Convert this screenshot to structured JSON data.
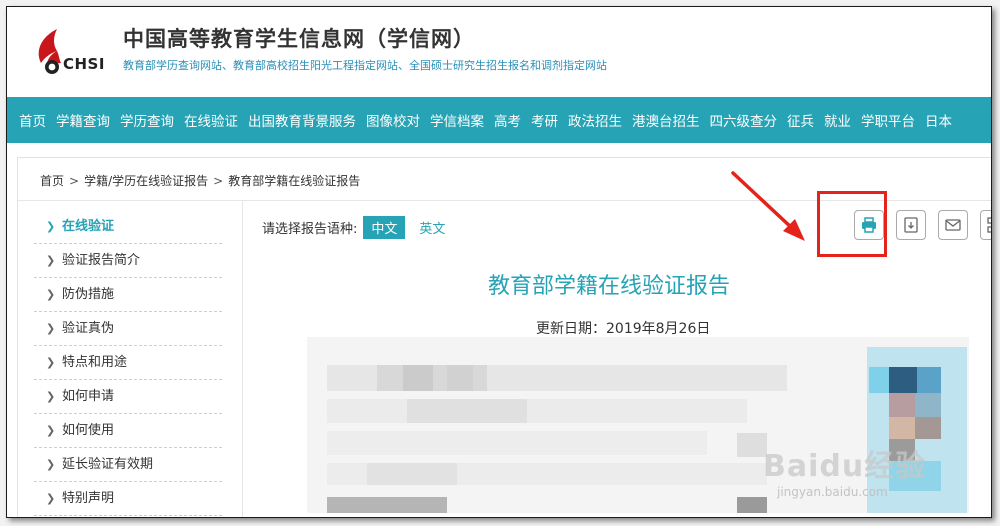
{
  "header": {
    "logo_text": "CHSI",
    "title": "中国高等教育学生信息网（学信网）",
    "subtitle": "教育部学历查询网站、教育部高校招生阳光工程指定网站、全国硕士研究生招生报名和调剂指定网站"
  },
  "nav": [
    "首页",
    "学籍查询",
    "学历查询",
    "在线验证",
    "出国教育背景服务",
    "图像校对",
    "学信档案",
    "高考",
    "考研",
    "政法招生",
    "港澳台招生",
    "四六级查分",
    "征兵",
    "就业",
    "学职平台",
    "日本"
  ],
  "breadcrumb": [
    "首页",
    "学籍/学历在线验证报告",
    "教育部学籍在线验证报告"
  ],
  "breadcrumb_sep": ">",
  "sidebar": [
    "在线验证",
    "验证报告简介",
    "防伪措施",
    "验证真伪",
    "特点和用途",
    "如何申请",
    "如何使用",
    "延长验证有效期",
    "特别声明"
  ],
  "language": {
    "label": "请选择报告语种:",
    "chinese": "中文",
    "english": "英文"
  },
  "report": {
    "title": "教育部学籍在线验证报告",
    "update_date": "更新日期：2019年8月26日"
  },
  "tools": [
    "print-icon",
    "save-icon",
    "mail-icon",
    "qrcode-icon"
  ],
  "watermark": {
    "main": "Baidu经验",
    "sub": "jingyan.baidu.com"
  },
  "colors": {
    "accent": "#26a3b5",
    "annotation": "#e4231a"
  }
}
